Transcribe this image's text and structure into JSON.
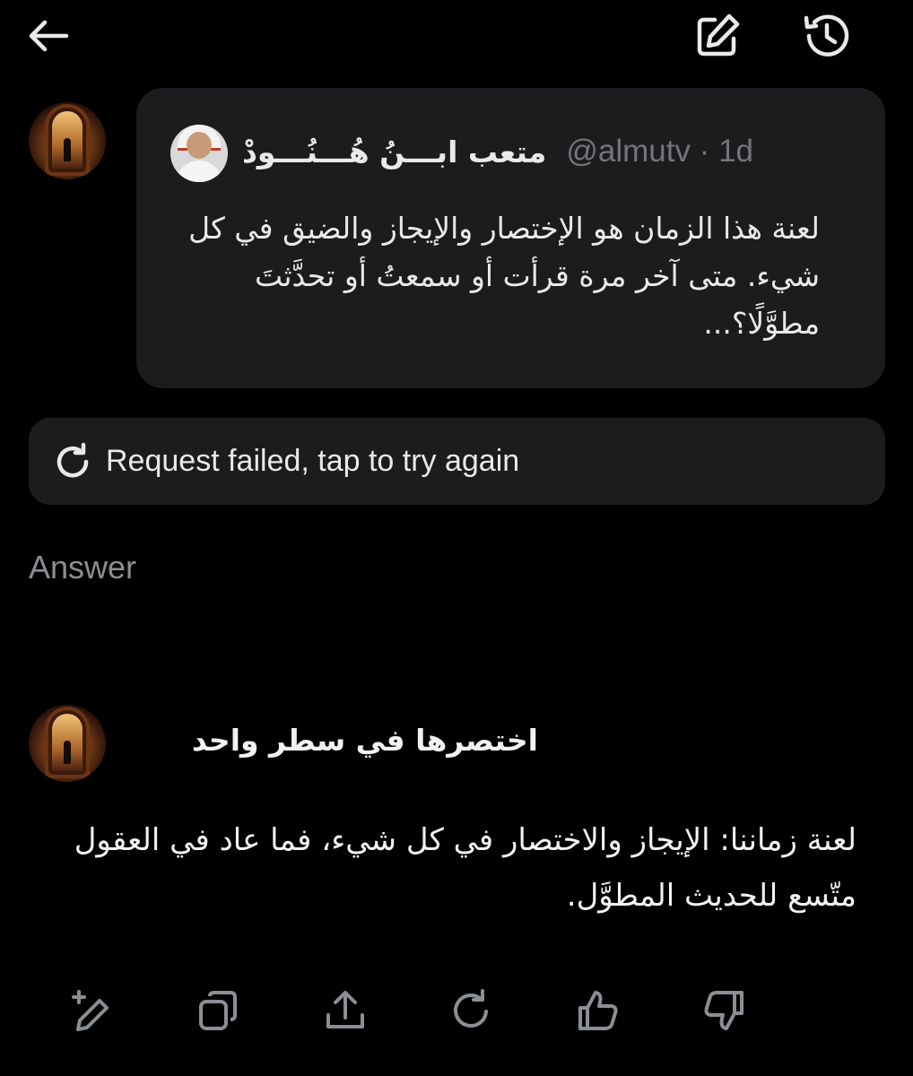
{
  "quoted_post": {
    "author_name": "متعب ابـــنُ هُـــنُـــودْ",
    "handle_time": "@almutv · 1d",
    "text": "لعنة هذا الزمان هو الإختصار والإيجاز والضيق في كل شيء. متى آخر مرة قرأت أو سمعتُ أو تحدَّثتَ مطوَّلًا؟..."
  },
  "error": {
    "message": "Request failed, tap to try again"
  },
  "answer_section": {
    "label": "Answer"
  },
  "user_prompt": {
    "text": "اختصرها في سطر واحد"
  },
  "answer": {
    "text": "لعنة زماننا: الإيجاز والاختصار في كل شيء، فما عاد في العقول متّسع للحديث المطوَّل."
  },
  "icons": {
    "back": "arrow-left-icon",
    "new_chat": "compose-icon",
    "history": "history-icon",
    "retry": "refresh-icon",
    "actions": [
      "edit-sparkle-icon",
      "copy-icon",
      "share-icon",
      "regenerate-icon",
      "thumbs-up-icon",
      "thumbs-down-icon"
    ]
  },
  "colors": {
    "background": "#000000",
    "card": "#1c1c1e",
    "text": "#e7e9ea",
    "muted": "#71767b"
  }
}
